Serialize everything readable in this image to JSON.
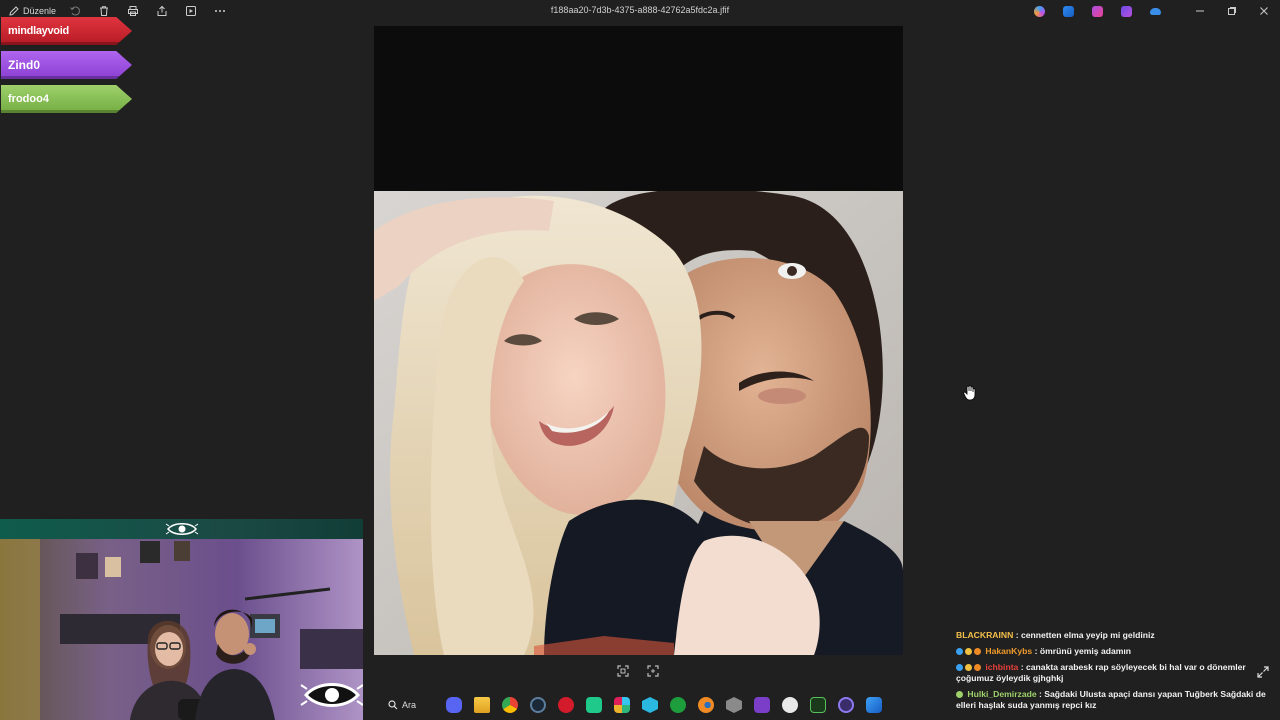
{
  "window": {
    "title": "f188aa20-7d3b-4375-a888-42762a5fdc2a.jfif",
    "edit_label": "Düzenle",
    "colors": {
      "background": "#202020",
      "viewer_bg": "#0c0c0c"
    }
  },
  "toolbar": {
    "items": [
      "edit-icon",
      "rotate-icon",
      "delete-icon",
      "print-icon",
      "share-icon",
      "slideshow-icon",
      "more-icon"
    ]
  },
  "window_controls": [
    "minimize",
    "restore",
    "close"
  ],
  "overlay_names": [
    {
      "name": "mindlayvoid",
      "color": "#d42a34"
    },
    {
      "name": "Zind0",
      "color": "#9d52e2"
    },
    {
      "name": "frodoo4",
      "color": "#8ac057"
    }
  ],
  "taskbar": {
    "search_label": "Ara",
    "apps": [
      "discord",
      "files",
      "chrome",
      "steam",
      "opera",
      "app-green",
      "slack",
      "app-cyan",
      "xbox",
      "blender",
      "app-hex",
      "app-purple",
      "chatgpt",
      "photoshop-pt",
      "app-circle",
      "app-blue"
    ]
  },
  "chat": {
    "messages": [
      {
        "user": "BLACKRAINN",
        "user_color": "#f4c04b",
        "text": "cennetten elma yeyip mi geldiniz"
      },
      {
        "user": "HakanKybs",
        "user_color": "#f09a2b",
        "text": "ömrünü yemiş adamın"
      },
      {
        "user": "ichbinta",
        "user_color": "#e5403a",
        "text": "canakta arabesk rap söyleyecek bi hal var o dönemler çoğumuz öyleydik gjhghkj"
      },
      {
        "user": "Hulki_Demirzade",
        "user_color": "#9ed06b",
        "text": "Sağdaki Ulusta apaçi dansı yapan Tuğberk Sağdaki de elleri haşlak suda yanmış repci kız"
      }
    ]
  }
}
